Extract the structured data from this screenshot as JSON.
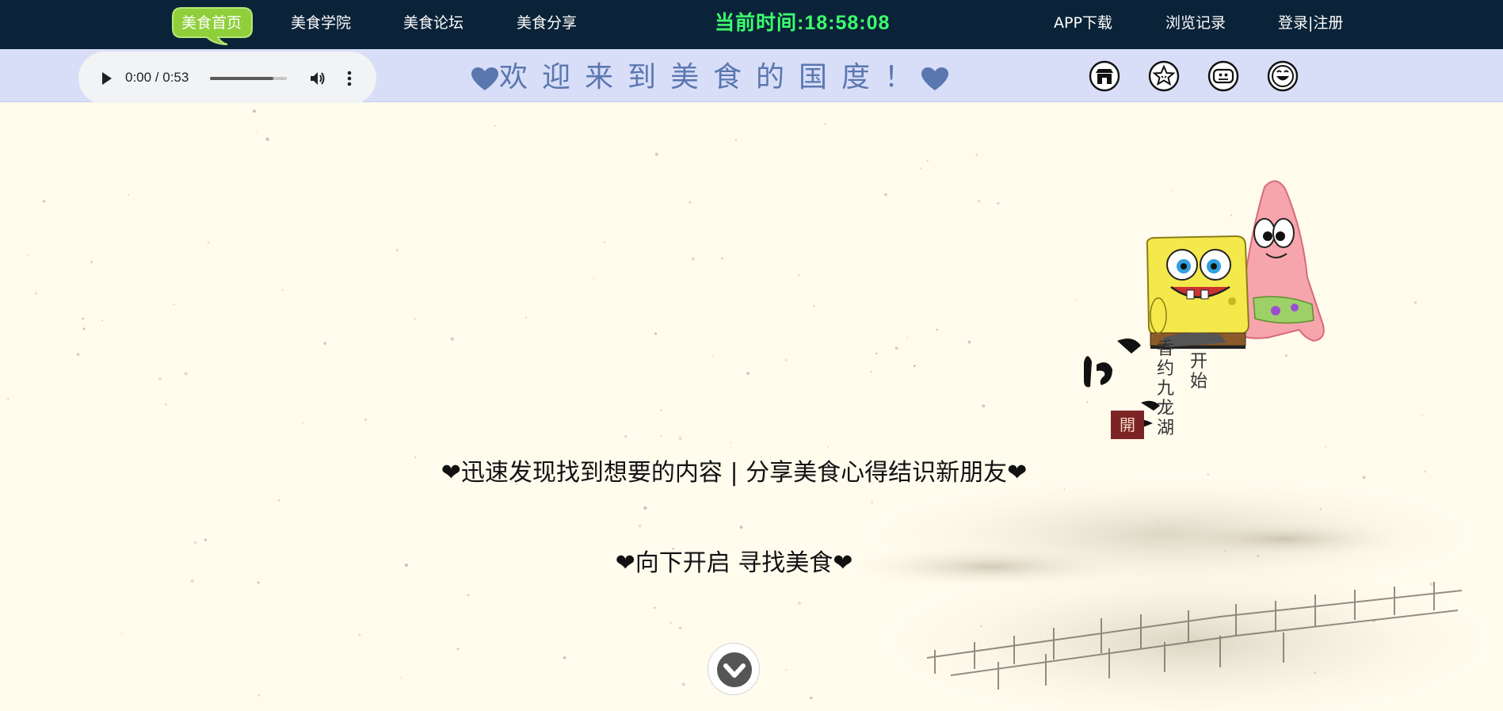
{
  "nav": {
    "items": [
      {
        "label": "美食首页",
        "active": true
      },
      {
        "label": "美食学院"
      },
      {
        "label": "美食论坛"
      },
      {
        "label": "美食分享"
      }
    ],
    "clock": "当前时间:18:58:08",
    "right_items": [
      {
        "label": "APP下载"
      },
      {
        "label": "浏览记录"
      },
      {
        "label": "登录|注册"
      }
    ]
  },
  "audio": {
    "time": "0:00 / 0:53",
    "volume_level": 0.82
  },
  "welcome": {
    "text": "欢迎来到美食的国度！",
    "heart_color": "#5b77b0"
  },
  "icons": [
    "house-icon",
    "star-face-icon",
    "gamepad-icon",
    "smiley-icon"
  ],
  "main": {
    "tagline_1": "❤迅速发现找到想要的内容 | 分享美食心得结识新朋友❤",
    "tagline_2": "❤向下开启 寻找美食❤",
    "calligraphy": {
      "col_1": "香约九龙湖",
      "col_2": "开始",
      "seal": "開"
    }
  },
  "colors": {
    "nav_bg": "#0b2338",
    "clock": "#3cff6e",
    "active_nav": "#8fcf3a",
    "welcome_bg": "#d8def8",
    "main_bg": "#fffcee"
  }
}
